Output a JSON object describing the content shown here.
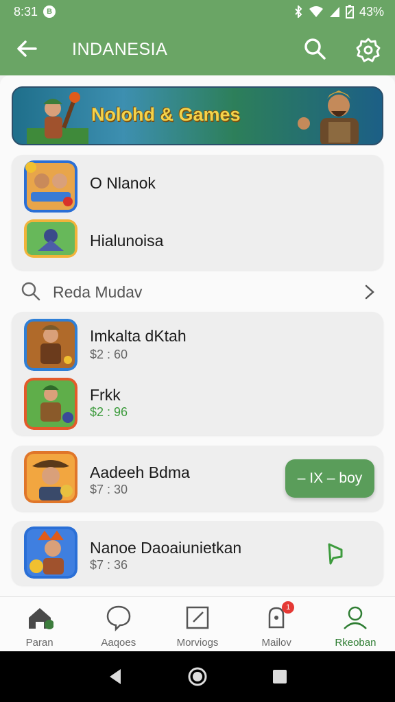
{
  "status_bar": {
    "time": "8:31",
    "notification": "B",
    "battery_text": "43%"
  },
  "app_bar": {
    "title": "INDANESIA",
    "back_icon": "arrow-left-icon",
    "search_icon": "search-icon",
    "settings_icon": "gear-icon"
  },
  "banner": {
    "title": "Nolohd & Games"
  },
  "featured": [
    {
      "title": "O Nlanok"
    },
    {
      "title": "Hialunoisa"
    }
  ],
  "section": {
    "label": "Reda Mudav"
  },
  "games": [
    {
      "title": "Imkalta dKtah",
      "price": "$2 : 60"
    },
    {
      "title": "Frkk",
      "price": "$2 : 96"
    },
    {
      "title": "Aadeeh Bdma",
      "price": "$7 : 30",
      "action": "– IX – boy"
    },
    {
      "title": "Nanoe Daoaiunietkan",
      "price": "$7 : 36"
    }
  ],
  "bottom_nav": [
    {
      "label": "Paran",
      "icon": "home-icon"
    },
    {
      "label": "Aaqoes",
      "icon": "chat-bubble-icon"
    },
    {
      "label": "Morviogs",
      "icon": "edit-icon"
    },
    {
      "label": "Mailov",
      "icon": "notification-icon",
      "badge": "1"
    },
    {
      "label": "Rkeoban",
      "icon": "profile-icon"
    }
  ],
  "colors": {
    "primary": "#6aa565",
    "accent_button": "#5a9d5a",
    "badge": "#e53935"
  }
}
